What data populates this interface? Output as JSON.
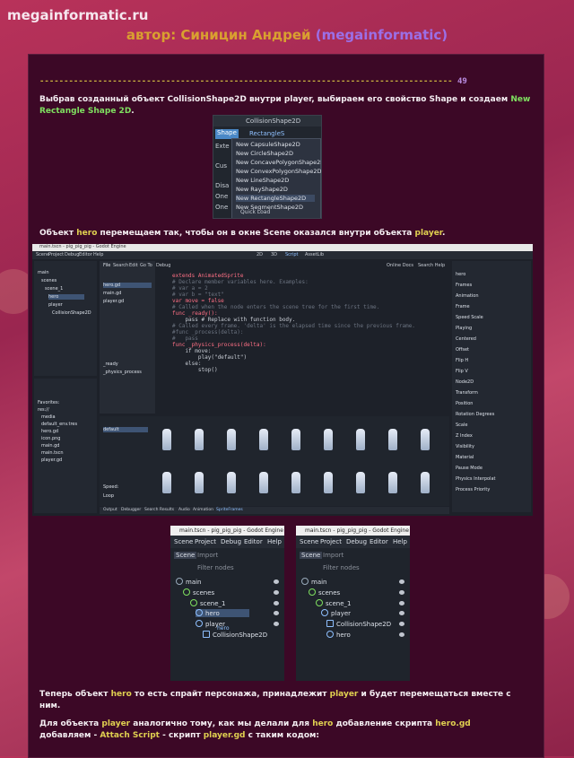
{
  "site": {
    "name": "megainformatic.ru"
  },
  "author": {
    "prefix": "автор: Синицин Андрей",
    "nick": "(megainformatic)"
  },
  "page": {
    "separator_dashes": "-------------------------------------------------------------------------------------",
    "number": "49"
  },
  "paragraphs": {
    "p1_a": "Выбрав созданный объект CollisionShape2D внутри player, выбираем его свойство Shape и создаем",
    "p1_hl": "New Rectangle Shape 2D",
    "p1_end": ".",
    "p2_a": "Объект ",
    "p2_hero": "hero",
    "p2_b": " перемещаем так, чтобы он в окне Scene оказался внутри объекта ",
    "p2_player": "player",
    "p2_end": ".",
    "p3_a": "Теперь объект ",
    "p3_hero": "hero",
    "p3_b": " то есть спрайт персонажа, принадлежит ",
    "p3_player": "player",
    "p3_c": " и будет перемещаться вместе с",
    "p3_d": "ним.",
    "p4_a": "Для объекта ",
    "p4_player": "player",
    "p4_b": " аналогично тому, как мы делали для ",
    "p4_hero": "hero",
    "p4_c": " добавление скрипта ",
    "p4_herogd": "hero.gd",
    "p5_a": "добавляем - ",
    "p5_attach": "Attach Script",
    "p5_b": " - скрипт ",
    "p5_playergd": "player.gd",
    "p5_c": " с таким кодом:"
  },
  "shape_popup": {
    "header": "CollisionShape2D",
    "prop": "Shape",
    "value": "RectangleS",
    "items": [
      "New CapsuleShape2D",
      "New CircleShape2D",
      "New ConcavePolygonShape2D",
      "New ConvexPolygonShape2D",
      "New LineShape2D",
      "New RayShape2D",
      "New RectangleShape2D",
      "New SegmentShape2D"
    ],
    "selected": "New RectangleShape2D",
    "side_labels": [
      "Exte",
      "Cus",
      "Disa",
      "One",
      "One"
    ],
    "footer": "Quick Load"
  },
  "editor": {
    "title": "main.tscn - pig_pig_pig - Godot Engine",
    "menu": [
      "Scene",
      "Project",
      "Debug",
      "Editor",
      "Help"
    ],
    "modes": [
      "2D",
      "3D",
      "Script",
      "AssetLib"
    ],
    "scene_tree": [
      "main",
      "scenes",
      "scene_1",
      "hero",
      "player",
      "CollisionShape2D"
    ],
    "script_tabs": [
      "File",
      "Search",
      "Edit",
      "Go To",
      "Debug"
    ],
    "scripts": [
      "hero.gd",
      "main.gd",
      "player.gd"
    ],
    "methods": [
      "_ready",
      "_physics_process"
    ],
    "code": [
      "extends AnimatedSprite",
      "",
      "# Declare member variables here. Examples:",
      "# var a = 2",
      "# var b = \"text\"",
      "",
      "var move = false",
      "",
      "# Called when the node enters the scene tree for the first time.",
      "func _ready():",
      "    pass # Replace with function body.",
      "",
      "# Called every frame. 'delta' is the elapsed time since the previous frame.",
      "#func _process(delta):",
      "#   pass",
      "",
      "func _physics_process(delta):",
      "    if move:",
      "        play(\"default\")",
      "    else:",
      "        stop()"
    ],
    "filesystem": [
      "Favorites:",
      "res://",
      "media",
      "default_env.tres",
      "hero.gd",
      "icon.png",
      "main.gd",
      "main.tscn",
      "player.gd"
    ],
    "bottom_tabs": [
      "Output",
      "Debugger",
      "Search Results",
      "Audio",
      "Animation",
      "SpriteFrames"
    ],
    "inspector": [
      "hero",
      "Frames",
      "Animation",
      "Frame",
      "Speed Scale",
      "Playing",
      "Centered",
      "Offset",
      "Flip H",
      "Flip V",
      "Node2D",
      "Transform",
      "Position",
      "Rotation Degrees",
      "Scale",
      "Z Index",
      "Visibility",
      "Material",
      "Pause Mode",
      "Physics Interpolat",
      "Process Priority"
    ],
    "online_docs": "Online Docs",
    "search_help": "Search Help",
    "anim_default": "default",
    "speed": "Speed:",
    "loop": "Loop"
  },
  "tree_left": {
    "title": "main.tscn - pig_pig_pig - Godot Engine",
    "nodes": [
      "main",
      "scenes",
      "scene_1",
      "hero",
      "player",
      "CollisionShape2D"
    ],
    "drag_label": "hero"
  },
  "tree_right": {
    "title": "main.tscn - pig_pig_pig - Godot Engine",
    "nodes": [
      "main",
      "scenes",
      "scene_1",
      "player",
      "CollisionShape2D",
      "hero"
    ]
  },
  "tree_common": {
    "menu": [
      "Scene",
      "Project",
      "Debug",
      "Editor",
      "Help"
    ],
    "tabs": [
      "Scene",
      "Import"
    ],
    "filter": "Filter nodes"
  }
}
